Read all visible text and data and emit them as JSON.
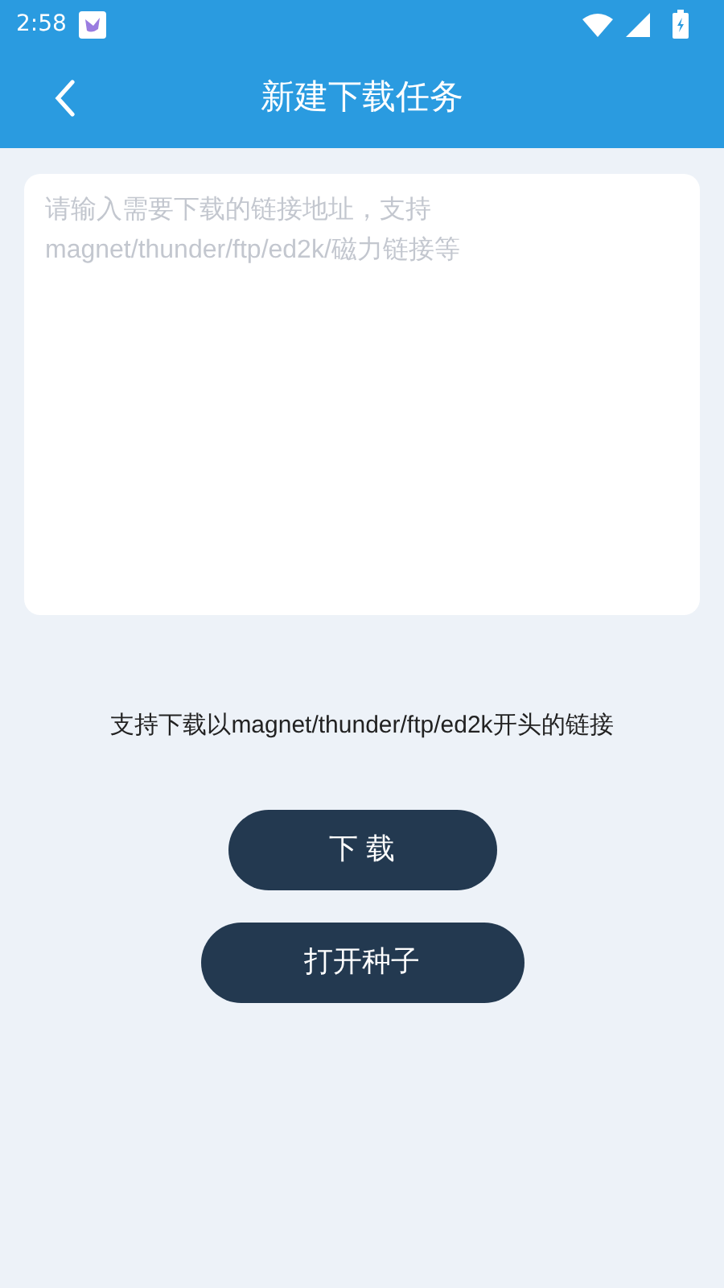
{
  "status_bar": {
    "time": "2:58"
  },
  "header": {
    "title": "新建下载任务"
  },
  "link_input": {
    "placeholder": "请输入需要下载的链接地址，支持magnet/thunder/ftp/ed2k/磁力链接等"
  },
  "hint": "支持下载以magnet/thunder/ftp/ed2k开头的链接",
  "buttons": [
    "下 载",
    "打开种子"
  ]
}
